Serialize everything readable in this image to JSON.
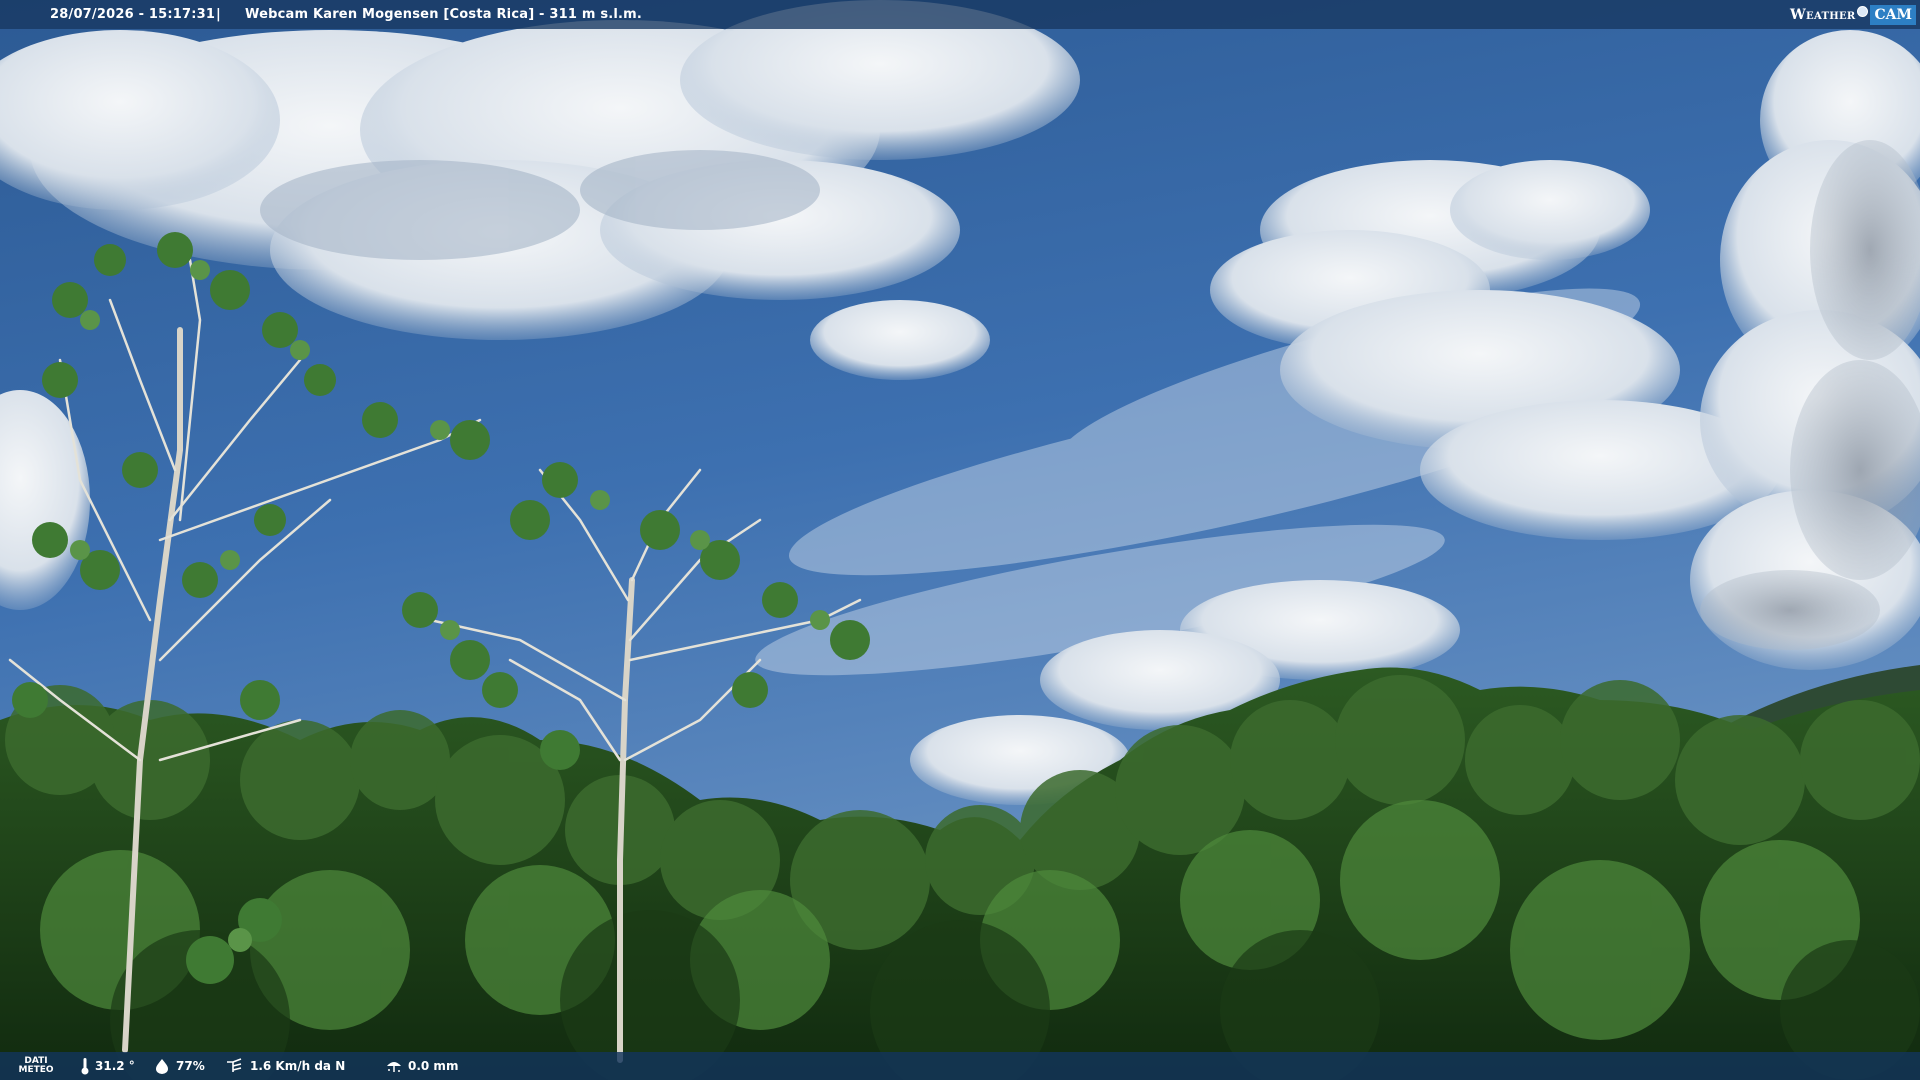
{
  "header": {
    "datetime": "28/07/2026 - 15:17:31",
    "separator": "|",
    "title": "Webcam Karen Mogensen [Costa Rica]  - 311 m s.l.m.",
    "brand_weather": "Weather",
    "brand_cam": "CAM"
  },
  "meteo": {
    "label_line1": "DATI",
    "label_line2": "METEO",
    "temperature": "31.2 °",
    "humidity": "77%",
    "wind": "1.6 Km/h da N",
    "rain": "0.0 mm",
    "icons": [
      "thermometer-icon",
      "humidity-drop-icon",
      "wind-icon",
      "rain-gauge-icon"
    ]
  },
  "colors": {
    "bar": "#173760",
    "brand_accent": "#2d7fc4",
    "sky": "#3a6cab"
  }
}
